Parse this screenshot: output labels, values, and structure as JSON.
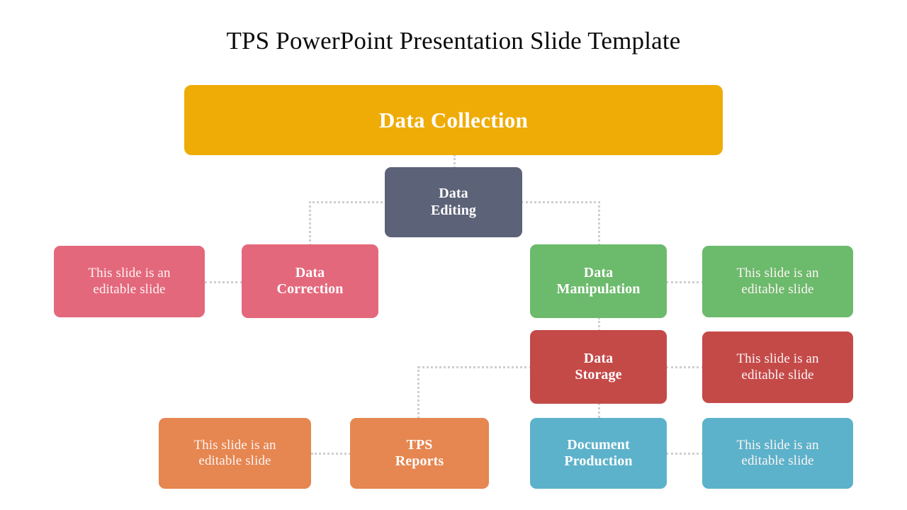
{
  "title": "TPS PowerPoint Presentation Slide Template",
  "colors": {
    "data_collection": "#efac06",
    "data_editing": "#5c6378",
    "pink": "#e4687c",
    "green": "#6cba6c",
    "red": "#c44a48",
    "orange": "#e68650",
    "blue": "#5cb2ca",
    "connector": "#cfcfcf",
    "title_text": "#0b0b0b",
    "node_text": "#ffffff",
    "background": "#ffffff"
  },
  "nodes": {
    "data_collection": {
      "label": "Data Collection",
      "color": "#efac06",
      "kind": "primary"
    },
    "data_editing": {
      "label": "Data\nEditing",
      "color": "#5c6378",
      "kind": "primary"
    },
    "correction_filler": {
      "label": "This slide is an\neditable slide",
      "color": "#e4687c",
      "kind": "filler"
    },
    "data_correction": {
      "label": "Data\nCorrection",
      "color": "#e4687c",
      "kind": "primary"
    },
    "data_manipulation": {
      "label": "Data\nManipulation",
      "color": "#6cba6c",
      "kind": "primary"
    },
    "manipulation_filler": {
      "label": "This slide is an\neditable slide",
      "color": "#6cba6c",
      "kind": "filler"
    },
    "data_storage": {
      "label": "Data\nStorage",
      "color": "#c44a48",
      "kind": "primary"
    },
    "storage_filler": {
      "label": "This slide is an\neditable slide",
      "color": "#c44a48",
      "kind": "filler"
    },
    "reports_filler": {
      "label": "This slide is an\neditable slide",
      "color": "#e68650",
      "kind": "filler"
    },
    "tps_reports": {
      "label": "TPS\nReports",
      "color": "#e68650",
      "kind": "primary"
    },
    "document_production": {
      "label": "Document\nProduction",
      "color": "#5cb2ca",
      "kind": "primary"
    },
    "document_filler": {
      "label": "This slide is an\neditable slide",
      "color": "#5cb2ca",
      "kind": "filler"
    }
  },
  "chart_data": {
    "type": "diagram",
    "title": "TPS PowerPoint Presentation Slide Template",
    "diagram_kind": "process-flow-tree",
    "levels": [
      {
        "level": 0,
        "nodes": [
          "Data Collection"
        ]
      },
      {
        "level": 1,
        "nodes": [
          "Data Editing"
        ]
      },
      {
        "level": 2,
        "nodes": [
          "Data Correction",
          "Data Manipulation"
        ]
      },
      {
        "level": 3,
        "nodes": [
          "Data Storage"
        ]
      },
      {
        "level": 4,
        "nodes": [
          "TPS Reports",
          "Document Production"
        ]
      }
    ],
    "edges": [
      {
        "from": "Data Collection",
        "to": "Data Editing",
        "style": "dotted"
      },
      {
        "from": "Data Editing",
        "to": "Data Correction",
        "style": "dotted-elbow-left"
      },
      {
        "from": "Data Editing",
        "to": "Data Manipulation",
        "style": "dotted-elbow-right"
      },
      {
        "from": "Data Correction",
        "to": "This slide is an editable slide (pink)",
        "style": "dotted"
      },
      {
        "from": "Data Manipulation",
        "to": "This slide is an editable slide (green)",
        "style": "dotted"
      },
      {
        "from": "Data Manipulation",
        "to": "Data Storage",
        "style": "dotted"
      },
      {
        "from": "Data Storage",
        "to": "This slide is an editable slide (red)",
        "style": "dotted"
      },
      {
        "from": "Data Storage",
        "to": "TPS Reports",
        "style": "dotted-elbow-left"
      },
      {
        "from": "Data Storage",
        "to": "Document Production",
        "style": "dotted"
      },
      {
        "from": "TPS Reports",
        "to": "This slide is an editable slide (orange)",
        "style": "dotted"
      },
      {
        "from": "Document Production",
        "to": "This slide is an editable slide (blue)",
        "style": "dotted"
      }
    ]
  }
}
